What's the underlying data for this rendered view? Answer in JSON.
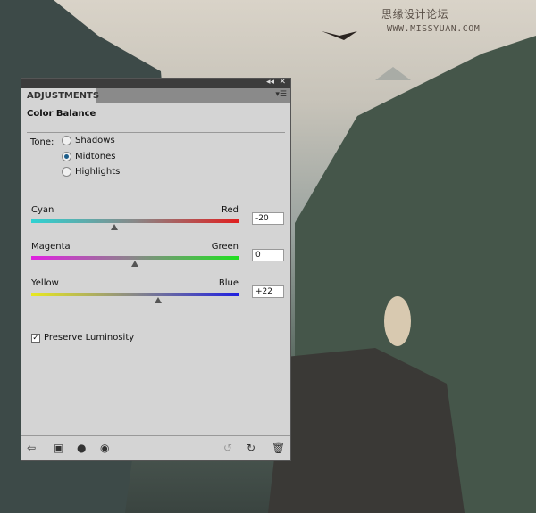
{
  "watermark": {
    "cn": "思缘设计论坛",
    "url": "WWW.MISSYUAN.COM"
  },
  "panel": {
    "tab": "ADJUSTMENTS",
    "title": "Color Balance",
    "collapse_icon": "double-chevron-left",
    "close_icon": "close",
    "tone": {
      "label": "Tone:",
      "options": [
        {
          "label": "Shadows",
          "selected": false
        },
        {
          "label": "Midtones",
          "selected": true
        },
        {
          "label": "Highlights",
          "selected": false
        }
      ]
    },
    "sliders": [
      {
        "left": "Cyan",
        "right": "Red",
        "value": "-20",
        "num": -20,
        "colors": [
          "#2fd2d2",
          "#e02020"
        ]
      },
      {
        "left": "Magenta",
        "right": "Green",
        "value": "0",
        "num": 0,
        "colors": [
          "#e020e0",
          "#20e020"
        ]
      },
      {
        "left": "Yellow",
        "right": "Blue",
        "value": "+22",
        "num": 22,
        "colors": [
          "#e8e820",
          "#2020e0"
        ]
      }
    ],
    "preserve": {
      "label": "Preserve Luminosity",
      "checked": true
    }
  }
}
